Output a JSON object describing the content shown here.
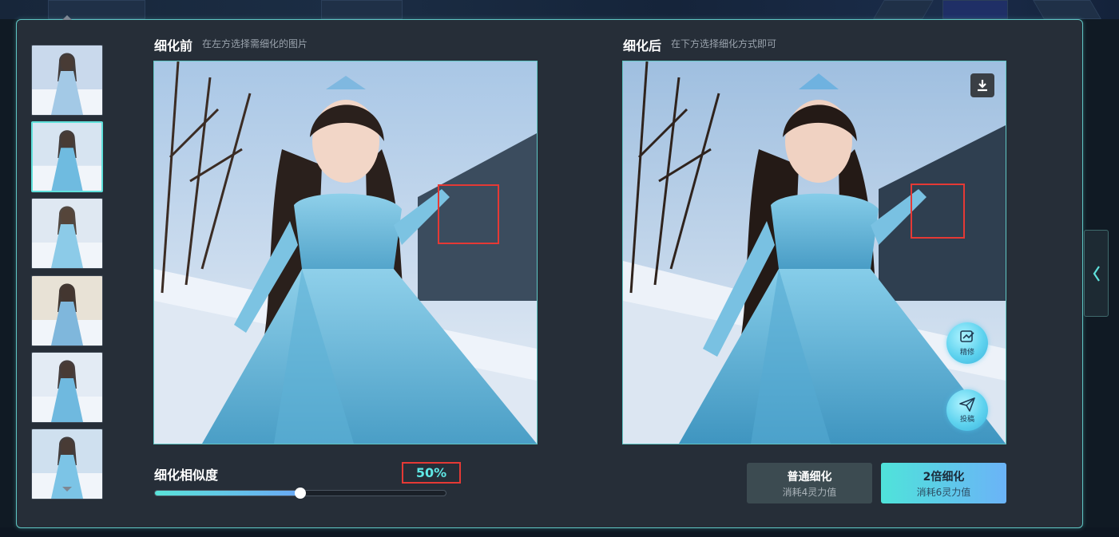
{
  "before": {
    "title": "细化前",
    "hint": "在左方选择需细化的图片"
  },
  "after": {
    "title": "细化后",
    "hint": "在下方选择细化方式即可",
    "refine_label": "精修",
    "post_label": "投稿"
  },
  "thumbnails": [
    {
      "scene": "portrait-indoor",
      "selected": false
    },
    {
      "scene": "snow-forest",
      "selected": true
    },
    {
      "scene": "snow-road",
      "selected": false
    },
    {
      "scene": "palace-column",
      "selected": false
    },
    {
      "scene": "snow-trees",
      "selected": false
    },
    {
      "scene": "snow-pines",
      "selected": false
    }
  ],
  "similarity": {
    "label": "细化相似度",
    "value_text": "50%",
    "value": 0.5
  },
  "actions": {
    "normal": {
      "title": "普通细化",
      "cost": "消耗4灵力值"
    },
    "double": {
      "title": "2倍细化",
      "cost": "消耗6灵力值"
    }
  },
  "colors": {
    "accent": "#5fe0db",
    "panel": "#262e38",
    "highlight_box": "#e53935"
  },
  "icons": [
    "chevron-up-icon",
    "chevron-down-icon",
    "download-icon",
    "refine-icon",
    "send-icon",
    "chevron-left-icon"
  ]
}
